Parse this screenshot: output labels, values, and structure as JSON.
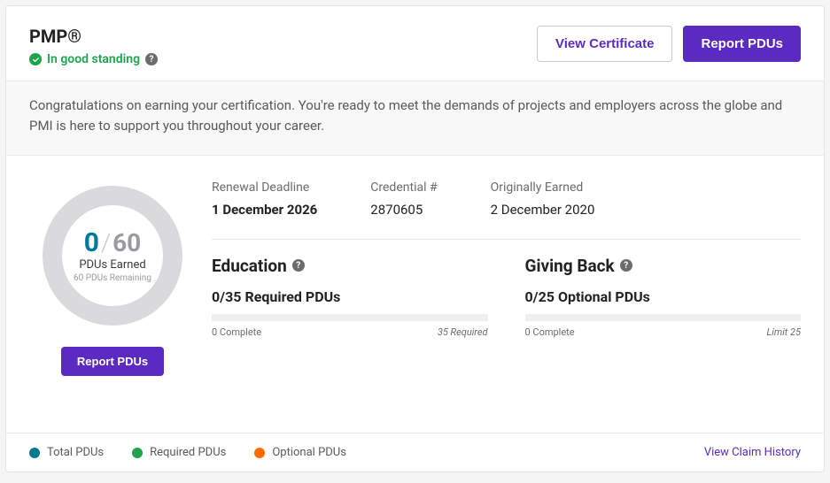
{
  "cert_title": "PMP®",
  "status": {
    "text": "In good standing"
  },
  "buttons": {
    "view_cert": "View Certificate",
    "report_pdus": "Report PDUs"
  },
  "congrats": "Congratulations on earning your certification. You're ready to meet the demands of projects and employers across the globe and PMI is here to support you throughout your career.",
  "donut": {
    "earned": "0",
    "total": "60",
    "label": "PDUs Earned",
    "remaining": "60 PDUs Remaining"
  },
  "meta": {
    "renewal_label": "Renewal Deadline",
    "renewal_value": "1 December 2026",
    "cred_label": "Credential #",
    "cred_value": "2870605",
    "orig_label": "Originally Earned",
    "orig_value": "2 December 2020"
  },
  "education": {
    "title": "Education",
    "sub": "0/35 Required PDUs",
    "left": "0 Complete",
    "right": "35 Required"
  },
  "giving_back": {
    "title": "Giving Back",
    "sub": "0/25 Optional PDUs",
    "left": "0 Complete",
    "right": "Limit 25"
  },
  "legend": {
    "total": "Total PDUs",
    "required": "Required PDUs",
    "optional": "Optional PDUs"
  },
  "link_history": "View Claim History",
  "chart_data": {
    "type": "pie",
    "title": "PDUs Earned",
    "values": [
      0,
      60
    ],
    "categories": [
      "Earned",
      "Remaining"
    ],
    "annotations": [
      "0/60",
      "60 PDUs Remaining"
    ]
  }
}
